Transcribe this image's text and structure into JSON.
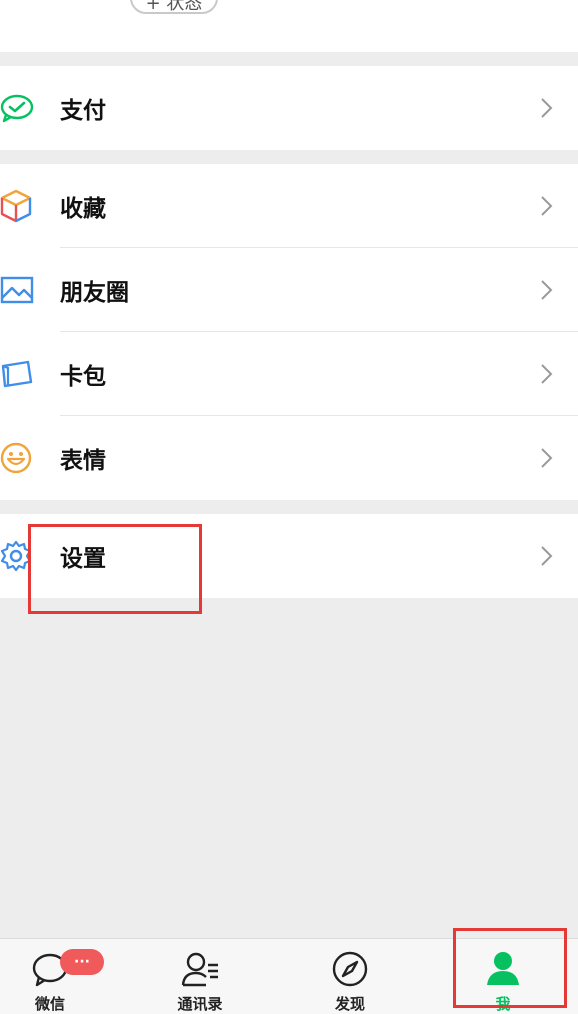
{
  "status_chip": {
    "label": "+ 状态"
  },
  "menu": {
    "pay": {
      "label": "支付",
      "icon": "wechat-pay-icon"
    },
    "favorites": {
      "label": "收藏",
      "icon": "favorites-cube-icon"
    },
    "moments": {
      "label": "朋友圈",
      "icon": "moments-image-icon"
    },
    "cards": {
      "label": "卡包",
      "icon": "card-wallet-icon"
    },
    "stickers": {
      "label": "表情",
      "icon": "smiley-icon"
    },
    "settings": {
      "label": "设置",
      "icon": "gear-icon"
    }
  },
  "tabbar": {
    "chats": {
      "label": "微信",
      "badge": "···",
      "icon": "chat-bubble-icon"
    },
    "contacts": {
      "label": "通讯录",
      "icon": "contacts-icon"
    },
    "discover": {
      "label": "发现",
      "icon": "compass-icon"
    },
    "me": {
      "label": "我",
      "icon": "person-icon",
      "active": true
    }
  },
  "colors": {
    "accent_green": "#07c160",
    "highlight_red": "#e53935",
    "badge_red": "#f05a5a"
  }
}
